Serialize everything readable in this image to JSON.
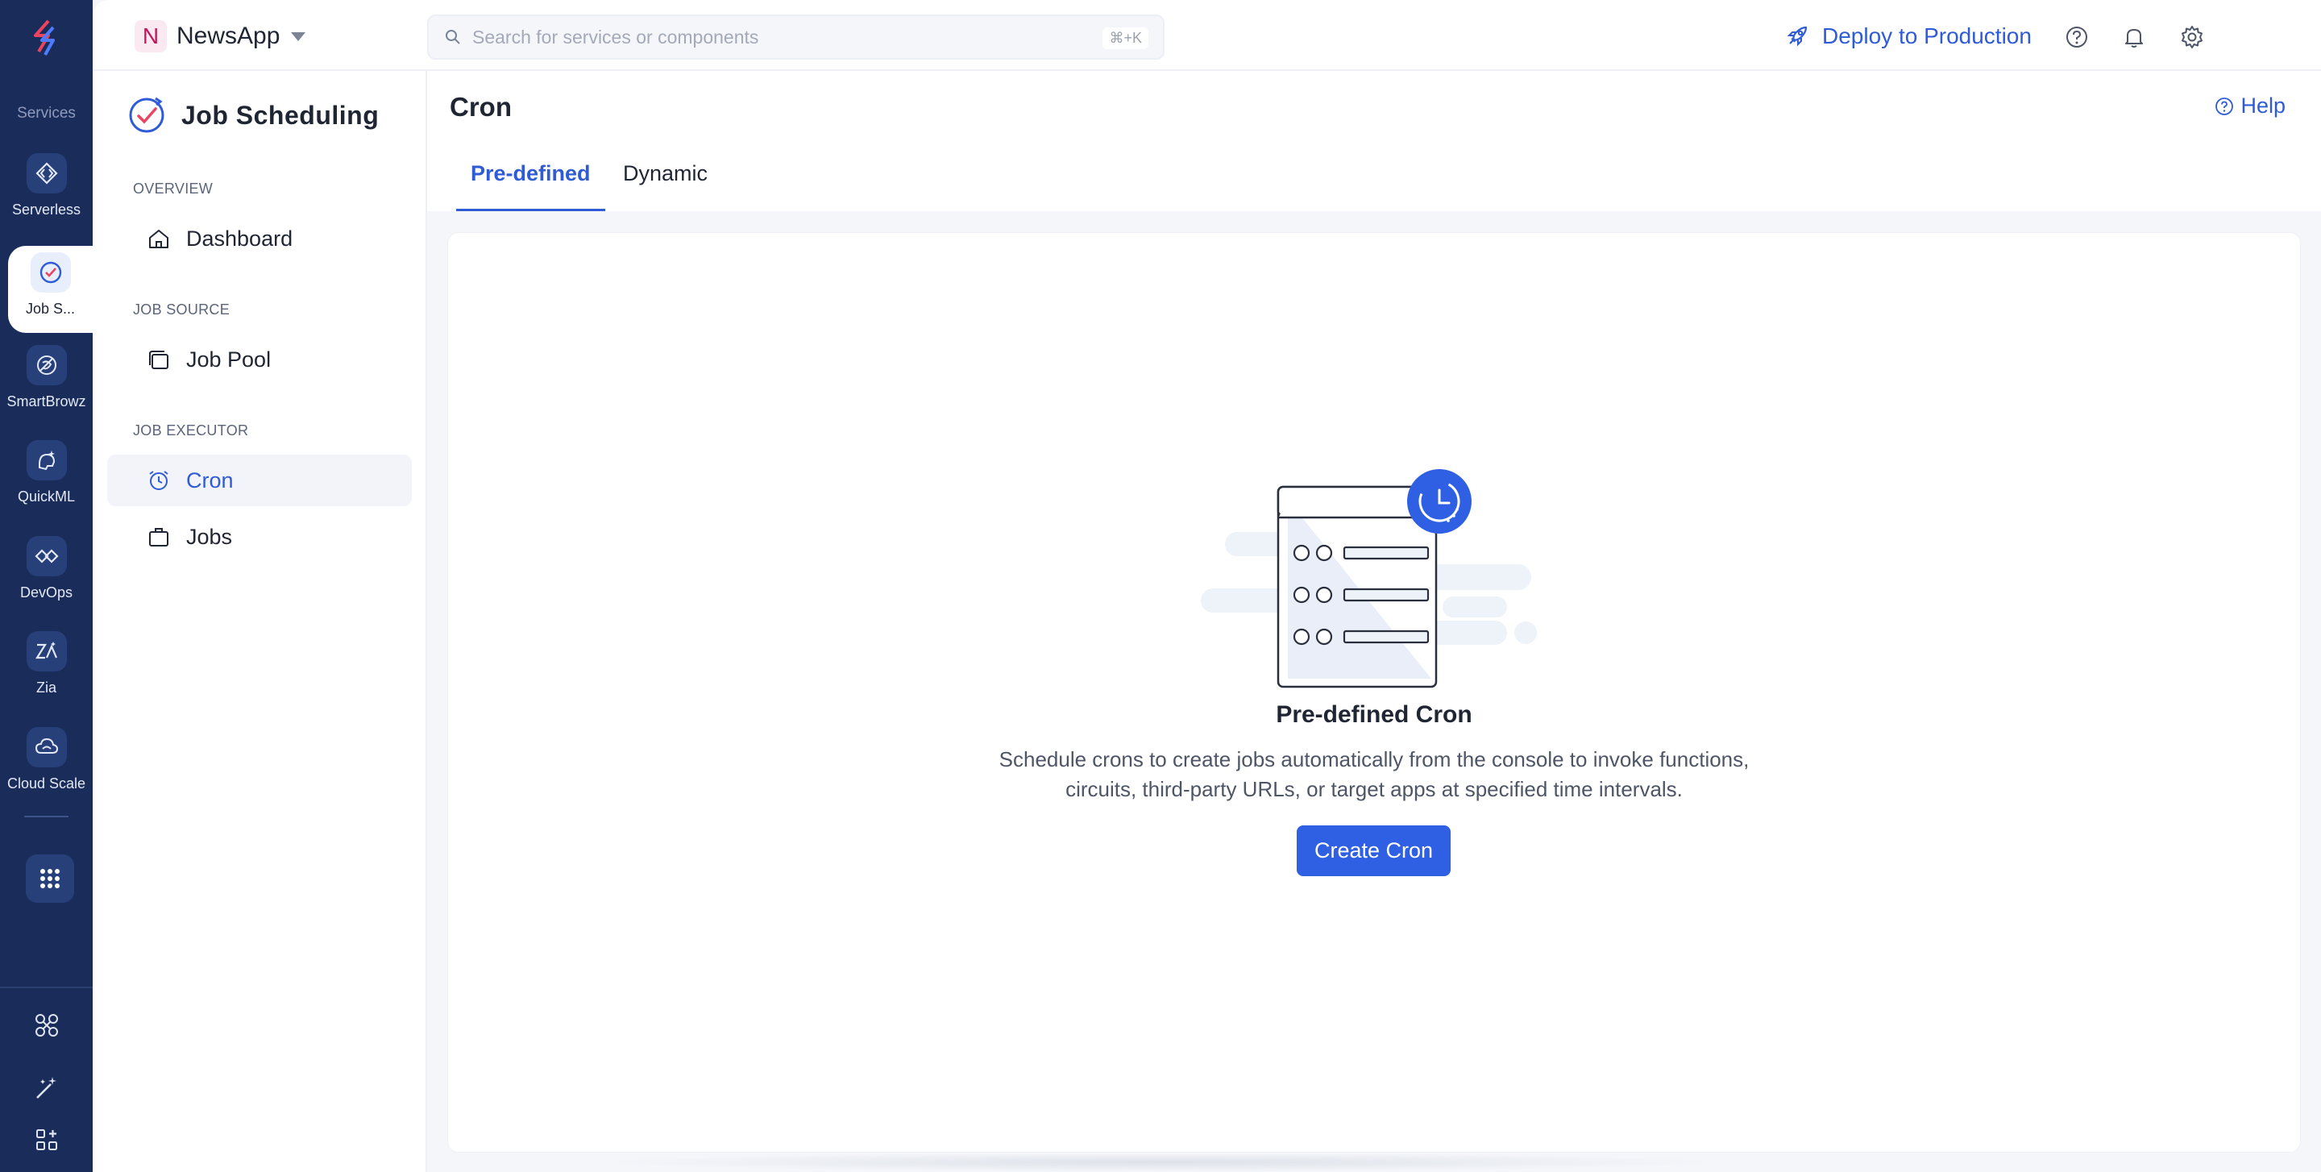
{
  "rail": {
    "section_label": "Services",
    "items": [
      {
        "label": "Serverless",
        "icon": "serverless-icon"
      },
      {
        "label": "Job S...",
        "icon": "job-scheduling-icon"
      },
      {
        "label": "SmartBrowz",
        "icon": "smartbrowz-icon"
      },
      {
        "label": "QuickML",
        "icon": "quickml-icon"
      },
      {
        "label": "DevOps",
        "icon": "devops-icon"
      },
      {
        "label": "Zia",
        "icon": "zia-icon"
      },
      {
        "label": "Cloud Scale",
        "icon": "cloud-scale-icon"
      }
    ]
  },
  "topbar": {
    "project_initial": "N",
    "project_name": "NewsApp",
    "search_placeholder": "Search for services or components",
    "search_shortcut": "⌘+K",
    "deploy_label": "Deploy to Production"
  },
  "sidebar": {
    "title": "Job Scheduling",
    "sections": [
      {
        "label": "OVERVIEW",
        "items": [
          "Dashboard"
        ]
      },
      {
        "label": "JOB SOURCE",
        "items": [
          "Job Pool"
        ]
      },
      {
        "label": "JOB EXECUTOR",
        "items": [
          "Cron",
          "Jobs"
        ]
      }
    ],
    "active_item": "Cron"
  },
  "main": {
    "title": "Cron",
    "help_label": "Help",
    "tabs": [
      {
        "label": "Pre-defined",
        "active": true
      },
      {
        "label": "Dynamic",
        "active": false
      }
    ],
    "empty_state": {
      "title": "Pre-defined Cron",
      "description_line1": "Schedule crons to create jobs automatically from the console to invoke functions,",
      "description_line2": "circuits, third-party URLs, or target apps at specified time intervals.",
      "button_label": "Create Cron"
    }
  },
  "colors": {
    "rail_bg": "#1a2c5a",
    "accent": "#2f5bd6",
    "button_bg": "#2f5fe3"
  }
}
